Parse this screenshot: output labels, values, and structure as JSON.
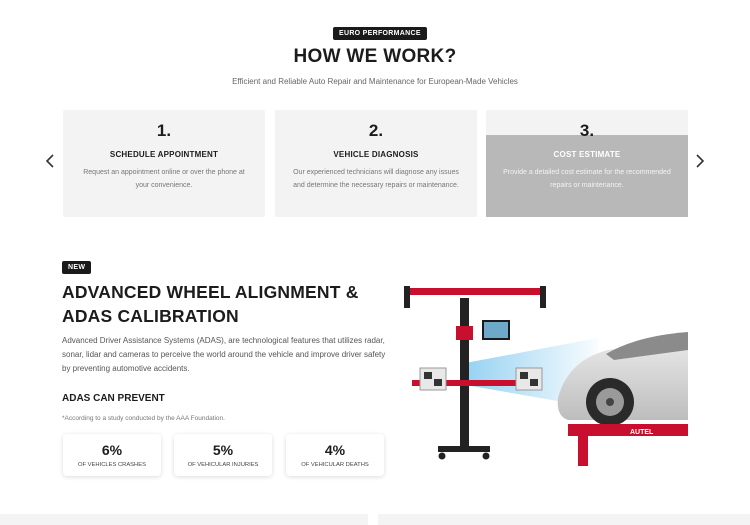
{
  "header": {
    "badge": "EURO PERFORMANCE",
    "title": "HOW WE WORK?",
    "subtitle": "Efficient and Reliable Auto Repair and Maintenance for European-Made Vehicles"
  },
  "carousel": {
    "prev_icon": "chevron-left-icon",
    "next_icon": "chevron-right-icon",
    "steps": [
      {
        "num": "1.",
        "title": "SCHEDULE APPOINTMENT",
        "desc": "Request an appointment online or over the phone at your convenience."
      },
      {
        "num": "2.",
        "title": "VEHICLE DIAGNOSIS",
        "desc": "Our experienced technicians will diagnose any issues and determine the necessary repairs or maintenance."
      },
      {
        "num": "3.",
        "title": "COST ESTIMATE",
        "desc": "Provide a detailed cost estimate for the recommended repairs or maintenance."
      }
    ]
  },
  "adas": {
    "badge": "NEW",
    "title": "ADVANCED WHEEL ALIGNMENT & ADAS CALIBRATION",
    "description": "Advanced Driver Assistance Systems (ADAS), are technological features that utilizes radar, sonar, lidar and cameras to perceive the world around the vehicle and improve driver safety by preventing automotive accidents.",
    "prevent_heading": "ADAS CAN PREVENT",
    "footnote": "*According to a study conducted by the AAA Foundation.",
    "stats": [
      {
        "value": "6%",
        "label": "OF VEHICLES CRASHES"
      },
      {
        "value": "5%",
        "label": "OF VEHICULAR INJURIES"
      },
      {
        "value": "4%",
        "label": "OF VEHICULAR DEATHS"
      }
    ],
    "image": {
      "brand": "AUTEL",
      "accent_red": "#c8102e",
      "beam_blue": "#7fc8ef"
    }
  }
}
